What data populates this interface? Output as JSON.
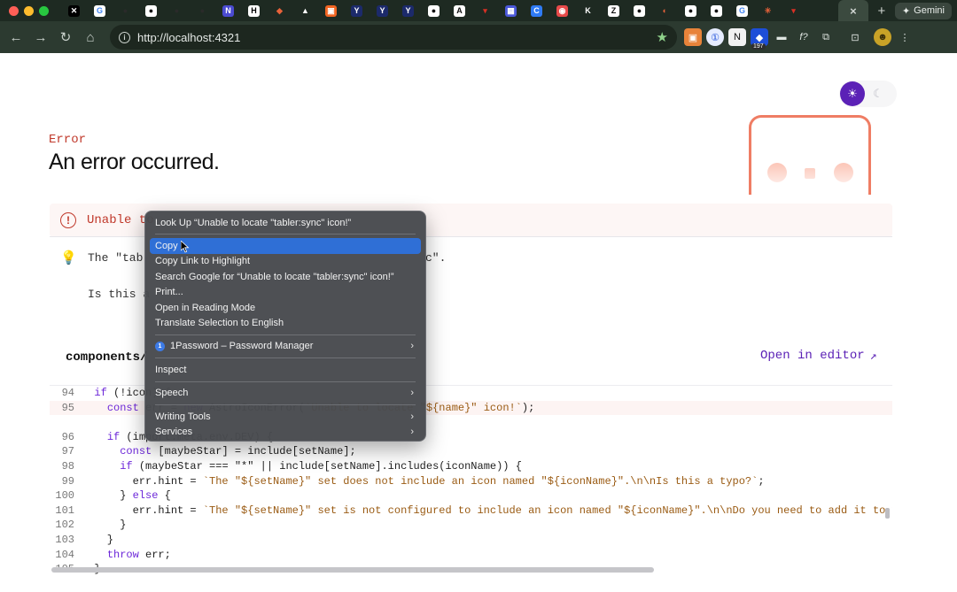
{
  "browser": {
    "tabs": [
      {
        "glyph": "✕",
        "bg": "#000000",
        "fg": "#ffffff"
      },
      {
        "glyph": "G",
        "bg": "#ffffff",
        "fg": "#4285f4"
      },
      {
        "glyph": "●",
        "bg": "#1e2a22",
        "fg": "#2a2a2a"
      },
      {
        "glyph": "●",
        "bg": "#ffffff",
        "fg": "#111111"
      },
      {
        "glyph": "●",
        "bg": "#1e2a22",
        "fg": "#2a2a2a"
      },
      {
        "glyph": "●",
        "bg": "#1e2a22",
        "fg": "#2a2a2a"
      },
      {
        "glyph": "N",
        "bg": "#4b4bd1",
        "fg": "#ffffff"
      },
      {
        "glyph": "H",
        "bg": "#ffffff",
        "fg": "#000000"
      },
      {
        "glyph": "◆",
        "bg": "#1e2a22",
        "fg": "#e8623a"
      },
      {
        "glyph": "▲",
        "bg": "#1e2a22",
        "fg": "#ffffff"
      },
      {
        "glyph": "▣",
        "bg": "#f26522",
        "fg": "#ffffff"
      },
      {
        "glyph": "Y",
        "bg": "#1c2a6b",
        "fg": "#ffffff"
      },
      {
        "glyph": "Y",
        "bg": "#1c2a6b",
        "fg": "#ffffff"
      },
      {
        "glyph": "Y",
        "bg": "#1c2a6b",
        "fg": "#ffffff"
      },
      {
        "glyph": "●",
        "bg": "#ffffff",
        "fg": "#111111"
      },
      {
        "glyph": "A",
        "bg": "#ffffff",
        "fg": "#111111"
      },
      {
        "glyph": "▾",
        "bg": "#1e2a22",
        "fg": "#d93025"
      },
      {
        "glyph": "▦",
        "bg": "#4b58d9",
        "fg": "#ffffff"
      },
      {
        "glyph": "C",
        "bg": "#2f7bf5",
        "fg": "#ffffff"
      },
      {
        "glyph": "◉",
        "bg": "#e84a4a",
        "fg": "#ffffff"
      },
      {
        "glyph": "K",
        "bg": "#1e2a22",
        "fg": "#ffffff"
      },
      {
        "glyph": "Z",
        "bg": "#ffffff",
        "fg": "#111111"
      },
      {
        "glyph": "●",
        "bg": "#ffffff",
        "fg": "#111111"
      },
      {
        "glyph": "◐",
        "bg": "#1e2a22",
        "fg": "#e8623a"
      },
      {
        "glyph": "●",
        "bg": "#ffffff",
        "fg": "#111111"
      },
      {
        "glyph": "●",
        "bg": "#ffffff",
        "fg": "#111111"
      },
      {
        "glyph": "G",
        "bg": "#ffffff",
        "fg": "#4285f4"
      },
      {
        "glyph": "✳",
        "bg": "#1e2a22",
        "fg": "#e8623a"
      },
      {
        "glyph": "▾",
        "bg": "#1e2a22",
        "fg": "#d93025"
      }
    ],
    "new_tab_symbol": "+",
    "close_tab_symbol": "×",
    "gemini_label": "Gemini",
    "url": "http://localhost:4321",
    "extensions_badge": "197"
  },
  "page": {
    "error_kind": "Error",
    "error_title": "An error occurred.",
    "error_message": "Unable to locate \"tabler:sync\" icon!",
    "error_message_visible": "Unable to",
    "hint_visible_start": "The \"tab",
    "hint_visible_end": "c\".",
    "typo_visible": "Is this a",
    "file_path_visible": "components/",
    "open_in_editor": "Open in editor",
    "code_lines": [
      {
        "n": "94",
        "text": "  if (!icon) {"
      },
      {
        "n": "95",
        "text": "    const err = new AstroIconError(`Unable to locate \"${name}\" icon!`);"
      },
      {
        "n": "",
        "text": ""
      },
      {
        "n": "96",
        "text": "    if (import.meta.env.DEV) {"
      },
      {
        "n": "97",
        "text": "      const [maybeStar] = include[setName];"
      },
      {
        "n": "98",
        "text": "      if (maybeStar === \"*\" || include[setName].includes(iconName)) {"
      },
      {
        "n": "99",
        "text": "        err.hint = `The \"${setName}\" set does not include an icon named \"${iconName}\".\\n\\nIs this a typo?`;"
      },
      {
        "n": "100",
        "text": "      } else {"
      },
      {
        "n": "101",
        "text": "        err.hint = `The \"${setName}\" set is not configured to include an icon named \"${iconName}\".\\n\\nDo you need to add it to your configuration?`;"
      },
      {
        "n": "102",
        "text": "      }"
      },
      {
        "n": "103",
        "text": "    }"
      },
      {
        "n": "104",
        "text": "    throw err;"
      },
      {
        "n": "105",
        "text": "  }"
      }
    ]
  },
  "context_menu": {
    "items": [
      {
        "label": "Look Up “Unable to locate \"tabler:sync\" icon!”",
        "submenu": false
      },
      {
        "sep": true
      },
      {
        "label": "Copy",
        "submenu": false,
        "selected": true
      },
      {
        "label": "Copy Link to Highlight",
        "submenu": false
      },
      {
        "label": "Search Google for “Unable to locate \"tabler:sync\" icon!”",
        "submenu": false
      },
      {
        "label": "Print...",
        "submenu": false
      },
      {
        "label": "Open in Reading Mode",
        "submenu": false
      },
      {
        "label": "Translate Selection to English",
        "submenu": false
      },
      {
        "sep": true
      },
      {
        "label": "1Password – Password Manager",
        "submenu": true,
        "icon": "1password-icon"
      },
      {
        "sep": true
      },
      {
        "label": "Inspect",
        "submenu": false
      },
      {
        "sep": true
      },
      {
        "label": "Speech",
        "submenu": true
      },
      {
        "sep": true
      },
      {
        "label": "Writing Tools",
        "submenu": true
      },
      {
        "label": "Services",
        "submenu": true
      }
    ]
  },
  "colors": {
    "accent": "#5b21b6",
    "error": "#c0392b",
    "menu_highlight": "#2f6fd6"
  }
}
